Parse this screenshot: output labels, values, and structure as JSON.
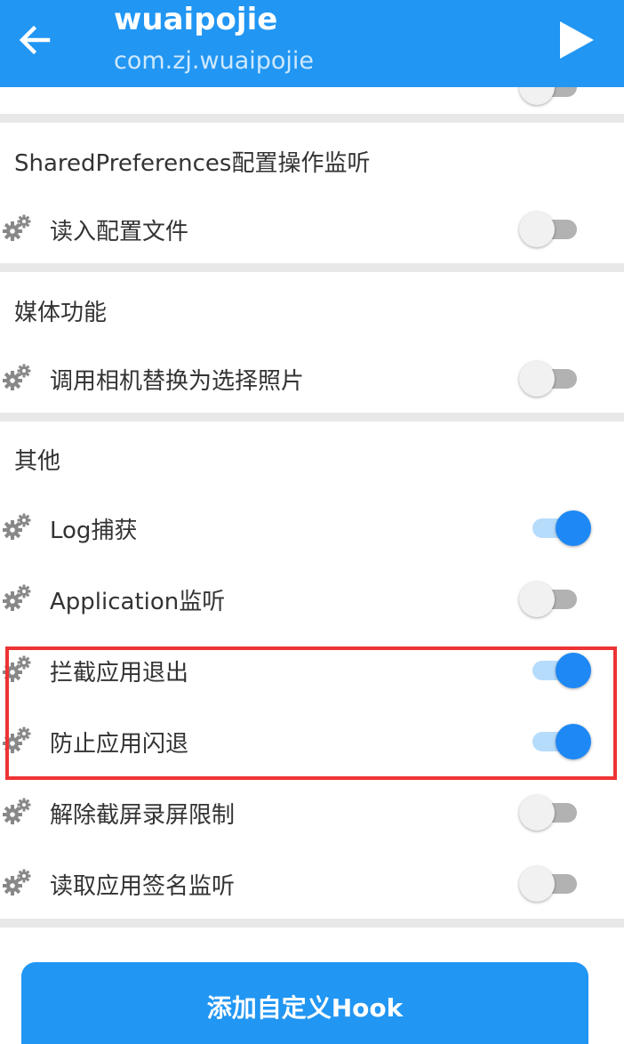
{
  "header": {
    "title": "wuaipojie",
    "subtitle": "com.zj.wuaipojie",
    "back_icon": "arrow-left-icon",
    "play_icon": "play-icon"
  },
  "colors": {
    "primary": "#2196F3",
    "switch_on": "#1E88F5",
    "switch_on_track": "#B6DCFC",
    "switch_off_thumb": "#F1F1F1",
    "switch_off_track": "#B2B2B2",
    "highlight": "#EE3333",
    "divider": "#E8E8E8"
  },
  "sections": [
    {
      "title": "SharedPreferences配置操作监听",
      "items": [
        {
          "label": "读入配置文件",
          "enabled": false
        }
      ]
    },
    {
      "title": "媒体功能",
      "items": [
        {
          "label": "调用相机替换为选择照片",
          "enabled": false
        }
      ]
    },
    {
      "title": "其他",
      "items": [
        {
          "label": "Log捕获",
          "enabled": true
        },
        {
          "label": "Application监听",
          "enabled": false
        },
        {
          "label": "拦截应用退出",
          "enabled": true
        },
        {
          "label": "防止应用闪退",
          "enabled": true
        },
        {
          "label": "解除截屏录屏限制",
          "enabled": false
        },
        {
          "label": "读取应用签名监听",
          "enabled": false
        }
      ]
    }
  ],
  "footer": {
    "add_hook_label": "添加自定义Hook"
  }
}
